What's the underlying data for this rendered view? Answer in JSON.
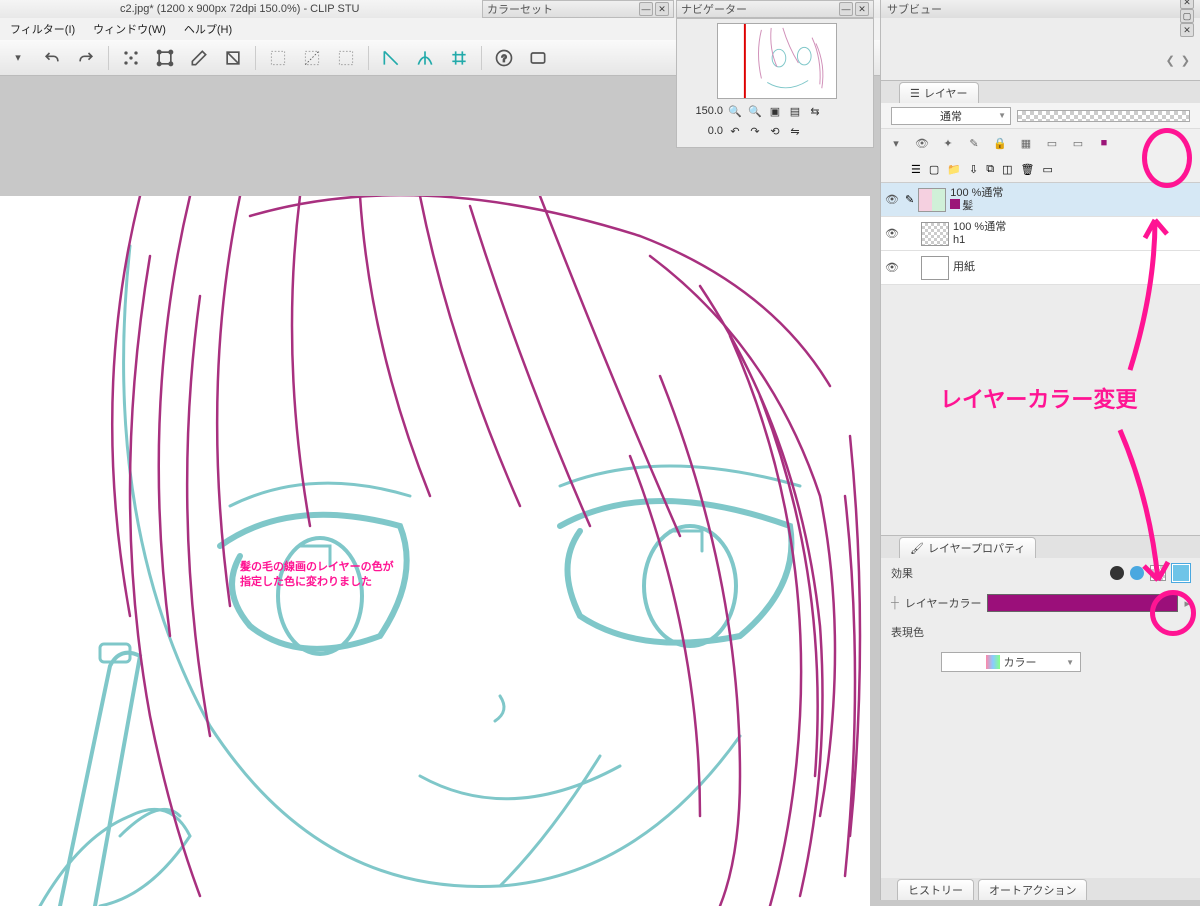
{
  "title": "c2.jpg* (1200 x 900px 72dpi 150.0%)  - CLIP STU",
  "menus": {
    "filter": "フィルター(I)",
    "window": "ウィンドウ(W)",
    "help": "ヘルプ(H)"
  },
  "panels": {
    "colorset": "カラーセット",
    "navigator": "ナビゲーター",
    "subview": "サブビュー",
    "layer": "レイヤー",
    "layerprop": "レイヤープロパティ",
    "history": "ヒストリー",
    "autoaction": "オートアクション"
  },
  "navigator": {
    "zoom": "150.0",
    "rotate": "0.0"
  },
  "layerPanel": {
    "blendMode": "通常",
    "layers": [
      {
        "opacity": "100 %通常",
        "name": "髪",
        "selected": true,
        "swatch": "#9b1578"
      },
      {
        "opacity": "100 %通常",
        "name": "h1",
        "selected": false
      },
      {
        "name": "用紙",
        "selected": false
      }
    ]
  },
  "layerProperty": {
    "effect": "効果",
    "layerColor": "レイヤーカラー",
    "expression": "表現色",
    "expressionValue": "カラー",
    "colorValue": "#9b0f7a"
  },
  "annotations": {
    "mainText1": "髪の毛の線画のレイヤーの色が",
    "mainText2": "指定した色に変わりました",
    "sideText": "レイヤーカラー変更"
  }
}
